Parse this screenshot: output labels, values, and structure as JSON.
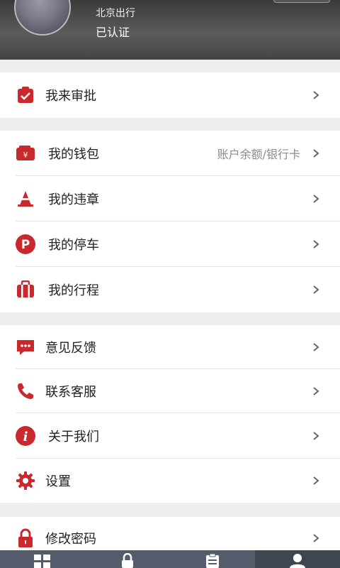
{
  "header": {
    "name": "北京出行",
    "status": "已认证"
  },
  "groups": [
    {
      "items": [
        {
          "label": "我来审批",
          "icon": "approval-icon"
        }
      ]
    },
    {
      "items": [
        {
          "label": "我的钱包",
          "sub": "账户余额/银行卡",
          "icon": "wallet-icon"
        },
        {
          "label": "我的违章",
          "icon": "traffic-cone-icon"
        },
        {
          "label": "我的停车",
          "icon": "parking-icon"
        },
        {
          "label": "我的行程",
          "icon": "luggage-icon"
        }
      ]
    },
    {
      "items": [
        {
          "label": "意见反馈",
          "icon": "feedback-icon"
        },
        {
          "label": "联系客服",
          "icon": "phone-icon"
        },
        {
          "label": "关于我们",
          "icon": "info-icon"
        },
        {
          "label": "设置",
          "icon": "gear-icon"
        }
      ]
    },
    {
      "items": [
        {
          "label": "修改密码",
          "icon": "lock-icon"
        }
      ]
    }
  ],
  "tabbar": {
    "tabs": [
      {
        "icon": "grid-icon",
        "active": false
      },
      {
        "icon": "lock-icon",
        "active": false
      },
      {
        "icon": "clipboard-icon",
        "active": false
      },
      {
        "icon": "person-icon",
        "active": true
      }
    ]
  },
  "colors": {
    "accent": "#c9282d",
    "tabbar": "#545c6b",
    "tabbar_active": "#3f4652"
  }
}
